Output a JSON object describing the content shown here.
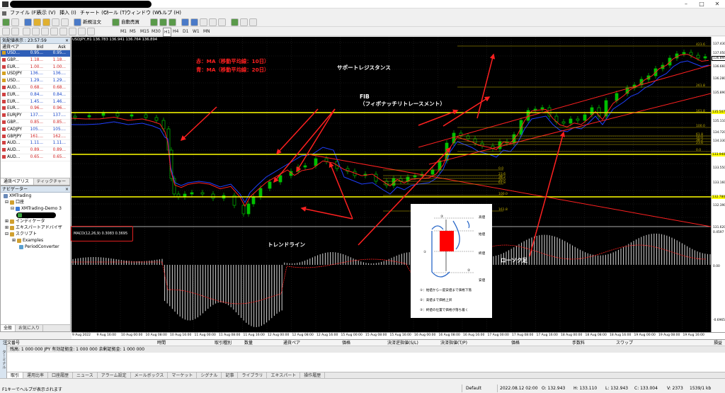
{
  "window": {
    "menu": [
      "ファイル (F)",
      "表示 (V)",
      "挿入 (I)",
      "チャート (C)",
      "ツール (T)",
      "ウィンドウ (W)",
      "ヘルプ (H)"
    ],
    "controls": [
      "–",
      "□",
      "✕"
    ]
  },
  "toolbar": {
    "new_order": "新規注文",
    "auto_trade": "自動売買",
    "timeframes": [
      "M1",
      "M5",
      "M15",
      "M30",
      "H1",
      "H4",
      "D1",
      "W1",
      "MN"
    ]
  },
  "market_watch": {
    "title": "気配値表示 : 23:57:59",
    "columns": [
      "通貨ペア",
      "Bid",
      "Ask"
    ],
    "rows": [
      {
        "symbol": "USD...",
        "bid": "0.95...",
        "ask": "0.95...",
        "dir": "up",
        "color": "#d4a020"
      },
      {
        "symbol": "GBP...",
        "bid": "1.18...",
        "ask": "1.18...",
        "dir": "dn",
        "color": "#d04040"
      },
      {
        "symbol": "EUR...",
        "bid": "1.00...",
        "ask": "1.00...",
        "dir": "dn",
        "color": "#d04040"
      },
      {
        "symbol": "USDJPY",
        "bid": "136....",
        "ask": "136....",
        "dir": "up",
        "color": "#d4a020"
      },
      {
        "symbol": "USD...",
        "bid": "1.29...",
        "ask": "1.29...",
        "dir": "up",
        "color": "#d4a020"
      },
      {
        "symbol": "AUD...",
        "bid": "0.68...",
        "ask": "0.68...",
        "dir": "dn",
        "color": "#d04040"
      },
      {
        "symbol": "EUR...",
        "bid": "0.84...",
        "ask": "0.84...",
        "dir": "up",
        "color": "#d04040"
      },
      {
        "symbol": "EUR...",
        "bid": "1.45...",
        "ask": "1.46...",
        "dir": "up",
        "color": "#d04040"
      },
      {
        "symbol": "EUR...",
        "bid": "0.96...",
        "ask": "0.96...",
        "dir": "dn",
        "color": "#d04040"
      },
      {
        "symbol": "EURJPY",
        "bid": "137....",
        "ask": "137....",
        "dir": "up",
        "color": "#d04040"
      },
      {
        "symbol": "GBP...",
        "bid": "0.85...",
        "ask": "0.85...",
        "dir": "dn",
        "color": "#d04040"
      },
      {
        "symbol": "CADJPY",
        "bid": "105....",
        "ask": "105....",
        "dir": "up",
        "color": "#d04040"
      },
      {
        "symbol": "GBPJPY",
        "bid": "161....",
        "ask": "162....",
        "dir": "dn",
        "color": "#d04040"
      },
      {
        "symbol": "AUD...",
        "bid": "1.11...",
        "ask": "1.11...",
        "dir": "up",
        "color": "#d04040"
      },
      {
        "symbol": "AUD...",
        "bid": "0.89...",
        "ask": "0.89...",
        "dir": "dn",
        "color": "#d04040"
      },
      {
        "symbol": "AUD...",
        "bid": "0.65...",
        "ask": "0.65...",
        "dir": "dn",
        "color": "#d04040"
      }
    ],
    "tabs": [
      "通貨ペアリスト",
      "ティックチャート"
    ]
  },
  "navigator": {
    "title": "ナビゲーター",
    "items": [
      "XMTrading",
      "口座",
      "XMTrading-Demo 3",
      "インディケータ",
      "エキスパートアドバイザ",
      "スクリプト",
      "Examples",
      "PeriodConverter"
    ],
    "tabs": [
      "全般",
      "お気に入り"
    ]
  },
  "chart": {
    "title": "USDJPY,H1  136.783 136.941 136.764 136.894",
    "macd_label": "MACD(12,26,9) 0.3083 0.3695",
    "price_labels": [
      "137.430",
      "137.050",
      "136.894",
      "136.660",
      "136.280",
      "135.890",
      "135.507",
      "135.110",
      "134.720",
      "134.330",
      "133.940",
      "133.550",
      "133.160",
      "132.780",
      "132.390",
      "131.620"
    ],
    "macd_labels": [
      "0.4597",
      "0.00",
      "-0.6965"
    ],
    "time_labels": [
      "9 Aug 2022",
      "9 Aug 16:00",
      "10 Aug 00:00",
      "10 Aug 08:00",
      "10 Aug 16:00",
      "11 Aug 00:00",
      "11 Aug 08:00",
      "11 Aug 16:00",
      "12 Aug 00:00",
      "12 Aug 08:00",
      "12 Aug 16:00",
      "15 Aug 00:00",
      "15 Aug 08:00",
      "15 Aug 16:00",
      "16 Aug 00:00",
      "16 Aug 08:00",
      "16 Aug 16:00",
      "17 Aug 00:00",
      "17 Aug 08:00",
      "17 Aug 16:00",
      "18 Aug 00:00",
      "18 Aug 08:00",
      "18 Aug 16:00",
      "19 Aug 00:00",
      "19 Aug 08:00",
      "19 Aug 16:00"
    ],
    "fib_labels_upper": [
      "423.6",
      "261.8",
      "161.8",
      "100.0",
      "61.8",
      "50.0",
      "38.2",
      "23.6",
      "0.0"
    ],
    "fib_labels_lower": [
      "0.0",
      "23.6",
      "38.2",
      "50.0",
      "61.8",
      "100.0",
      "161.8"
    ]
  },
  "annotations": {
    "ma_red": "赤：MA（移動平均線：10日）",
    "ma_blue": "青：MA（移動平均線：20日）",
    "support": "サポートレジスタンス",
    "fib_1": "FIB",
    "fib_2": "（フィボナッチリトレースメント）",
    "trend": "トレンドライン",
    "candle": "ローソク足"
  },
  "candle_inset": {
    "labels": [
      "高値",
      "始値",
      "終値",
      "安値"
    ],
    "markers": [
      "①",
      "②",
      "③"
    ],
    "notes": [
      "①：始値から一度安値まで価格下落",
      "②：高値まで価格上昇",
      "③：終値の位置で価格が落ち着く"
    ]
  },
  "terminal": {
    "side_label": "ターミナル",
    "columns": [
      "注文番号",
      "時間",
      "取引種別",
      "数量",
      "通貨ペア",
      "価格",
      "決済逆指値(S/L)",
      "決済指値(T/P)",
      "価格",
      "手数料",
      "スワップ",
      "損益"
    ],
    "balance": "残高: 1 000 000 JPY  有効証拠金: 1 000 000  余剰証拠金: 1 000 000",
    "tabs": [
      "取引",
      "運用比率",
      "口座履歴",
      "ニュース",
      "アラーム設定",
      "メールボックス",
      "マーケット",
      "シグナル",
      "記事",
      "ライブラリ",
      "エキスパート",
      "操作履歴"
    ]
  },
  "status": {
    "help": "F1キーでヘルプが表示されます",
    "profile": "Default",
    "datetime": "2022.08.12 02:00",
    "open": "O: 132.943",
    "high": "H: 133.110",
    "low": "L: 132.943",
    "close": "C: 133.004",
    "volume": "V: 2373",
    "traffic": "1539/1 kb"
  },
  "colors": {
    "accent_red": "#ff2020",
    "support_yellow": "#ffff00",
    "bull_candle": "#00c000",
    "ma_red": "#ff2020",
    "ma_blue": "#1f3fff",
    "fib": "#c8b400",
    "macd_hist": "#d8d8d8"
  }
}
